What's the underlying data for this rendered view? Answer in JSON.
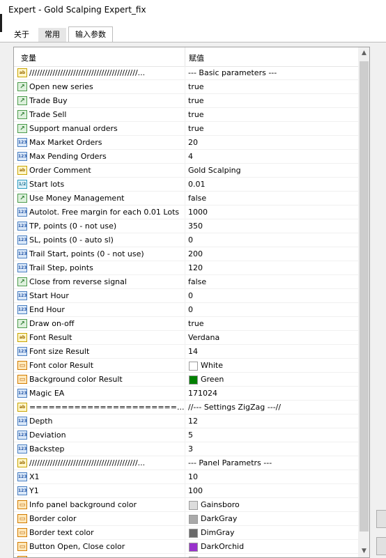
{
  "window": {
    "title": "Expert - Gold Scalping Expert_fix"
  },
  "tabs": [
    {
      "label": "关于"
    },
    {
      "label": "常用"
    },
    {
      "label": "输入参数"
    }
  ],
  "grid": {
    "headers": {
      "variable": "变量",
      "value": "赋值"
    },
    "rows": [
      {
        "type": "ab",
        "name": "//////////////////////////////////////////...",
        "value": "--- Basic parameters ---"
      },
      {
        "type": "bool",
        "name": "Open new series",
        "value": "true"
      },
      {
        "type": "bool",
        "name": "Trade Buy",
        "value": "true"
      },
      {
        "type": "bool",
        "name": "Trade Sell",
        "value": "true"
      },
      {
        "type": "bool",
        "name": "Support manual orders",
        "value": "true"
      },
      {
        "type": "int",
        "name": "Max Market Orders",
        "value": "20"
      },
      {
        "type": "int",
        "name": "Max Pending Orders",
        "value": "4"
      },
      {
        "type": "ab",
        "name": "Order Comment",
        "value": "Gold Scalping"
      },
      {
        "type": "dbl",
        "name": "Start lots",
        "value": "0.01"
      },
      {
        "type": "bool",
        "name": "Use Money Management",
        "value": "false"
      },
      {
        "type": "int",
        "name": "Autolot. Free margin for each 0.01 Lots",
        "value": "1000"
      },
      {
        "type": "int",
        "name": "TP, points (0 - not use)",
        "value": "350"
      },
      {
        "type": "int",
        "name": "SL, points (0 - auto sl)",
        "value": "0"
      },
      {
        "type": "int",
        "name": "Trail Start, points (0 - not use)",
        "value": "200"
      },
      {
        "type": "int",
        "name": "Trail Step, points",
        "value": "120"
      },
      {
        "type": "bool",
        "name": "Close from reverse signal",
        "value": "false"
      },
      {
        "type": "int",
        "name": "Start Hour",
        "value": "0"
      },
      {
        "type": "int",
        "name": "End Hour",
        "value": "0"
      },
      {
        "type": "bool",
        "name": "Draw on-off",
        "value": "true"
      },
      {
        "type": "ab",
        "name": "Font Result",
        "value": "Verdana"
      },
      {
        "type": "int",
        "name": "Font size Result",
        "value": "14"
      },
      {
        "type": "clr",
        "name": "Font color Result",
        "value": "White",
        "swatch": "#ffffff"
      },
      {
        "type": "clr",
        "name": "Background color Result",
        "value": "Green",
        "swatch": "#008000"
      },
      {
        "type": "int",
        "name": "Magic EA",
        "value": "171024"
      },
      {
        "type": "ab",
        "name": "=======================...",
        "value": "//--- Settings ZigZag ---//"
      },
      {
        "type": "int",
        "name": "Depth",
        "value": "12"
      },
      {
        "type": "int",
        "name": "Deviation",
        "value": "5"
      },
      {
        "type": "int",
        "name": "Backstep",
        "value": "3"
      },
      {
        "type": "ab",
        "name": "//////////////////////////////////////////...",
        "value": "--- Panel Parametrs ---"
      },
      {
        "type": "int",
        "name": "X1",
        "value": "10"
      },
      {
        "type": "int",
        "name": "Y1",
        "value": "100"
      },
      {
        "type": "clr",
        "name": "Info panel background color",
        "value": "Gainsboro",
        "swatch": "#dcdcdc"
      },
      {
        "type": "clr",
        "name": "Border color",
        "value": "DarkGray",
        "swatch": "#a9a9a9"
      },
      {
        "type": "clr",
        "name": "Border text color",
        "value": "DimGray",
        "swatch": "#696969"
      },
      {
        "type": "clr",
        "name": "Button Open, Close color",
        "value": "DarkOrchid",
        "swatch": "#9932cc"
      },
      {
        "type": "clr",
        "name": "",
        "value": "",
        "swatch": "#008000"
      }
    ]
  },
  "icons": {
    "ab": "ab",
    "bool": "↗",
    "int": "123",
    "dbl": "1/2",
    "clr": "▭"
  }
}
